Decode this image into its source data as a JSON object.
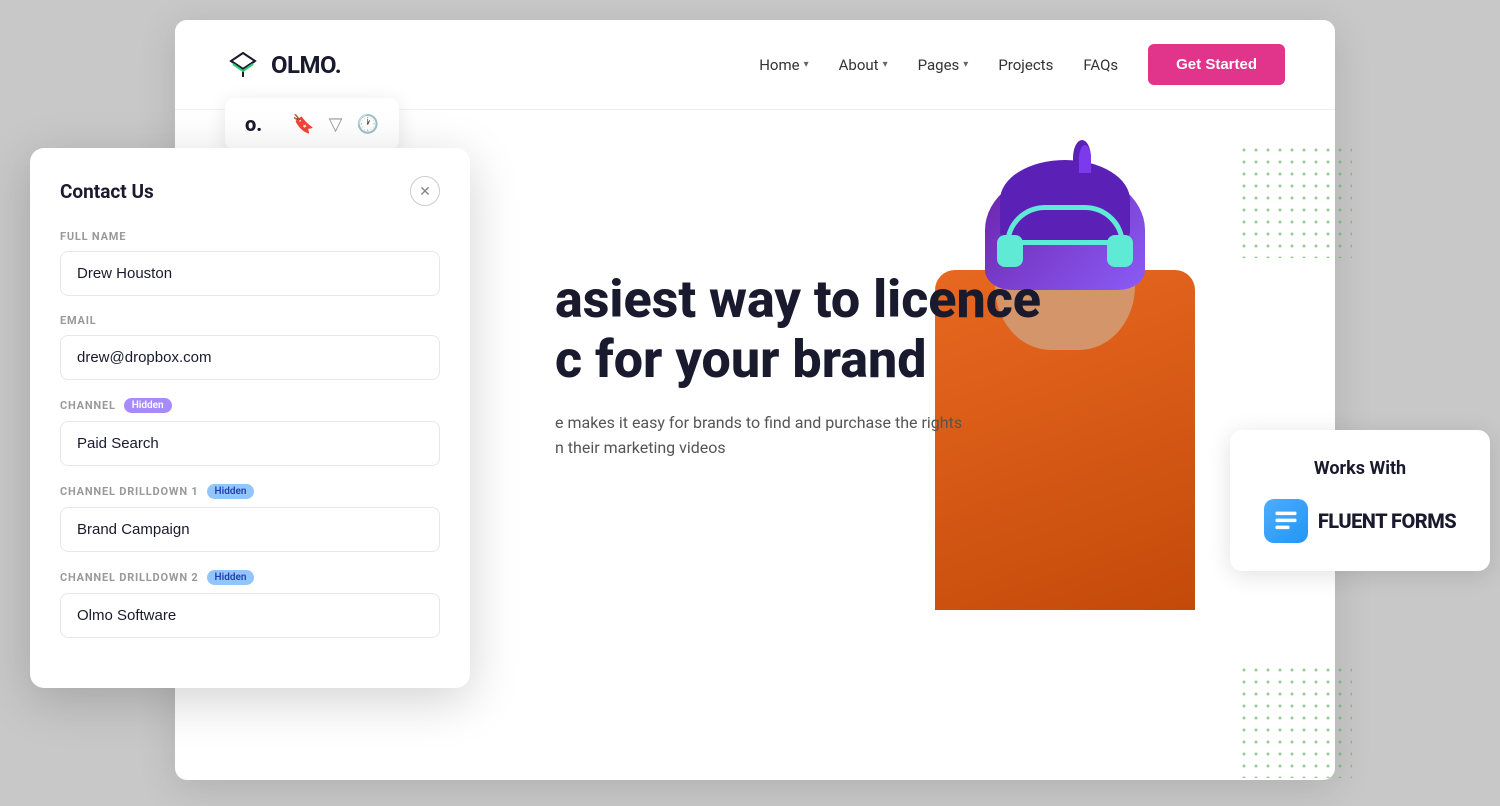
{
  "background": {
    "color": "#d8d8d8"
  },
  "navbar": {
    "logo_text": "OLMO.",
    "nav_items": [
      {
        "label": "Home",
        "has_dropdown": true
      },
      {
        "label": "About",
        "has_dropdown": true
      },
      {
        "label": "Pages",
        "has_dropdown": true
      },
      {
        "label": "Projects",
        "has_dropdown": false
      },
      {
        "label": "FAQs",
        "has_dropdown": false
      }
    ],
    "cta_label": "Get Started"
  },
  "hero": {
    "heading_line1": "asiest way to licence",
    "heading_line2": "c for your brand",
    "subtext": "e makes it easy for brands to find and purchase the rights",
    "subtext2": "n their marketing videos",
    "small_card_text": "o."
  },
  "works_with": {
    "title": "Works With",
    "brand": "FLUENT FORMS"
  },
  "contact_modal": {
    "title": "Contact Us",
    "fields": [
      {
        "label": "FULL NAME",
        "type": "text",
        "value": "Drew Houston",
        "has_badge": false
      },
      {
        "label": "EMAIL",
        "type": "email",
        "value": "drew@dropbox.com",
        "has_badge": false
      },
      {
        "label": "CHANNEL",
        "type": "text",
        "value": "Paid Search",
        "has_badge": true,
        "badge_label": "Hidden",
        "badge_style": "purple"
      },
      {
        "label": "CHANNEL DRILLDOWN 1",
        "type": "text",
        "value": "Brand Campaign",
        "has_badge": true,
        "badge_label": "Hidden",
        "badge_style": "blue"
      },
      {
        "label": "CHANNEL DRILLDOWN 2",
        "type": "text",
        "value": "Olmo Software",
        "has_badge": true,
        "badge_label": "Hidden",
        "badge_style": "blue"
      }
    ]
  }
}
